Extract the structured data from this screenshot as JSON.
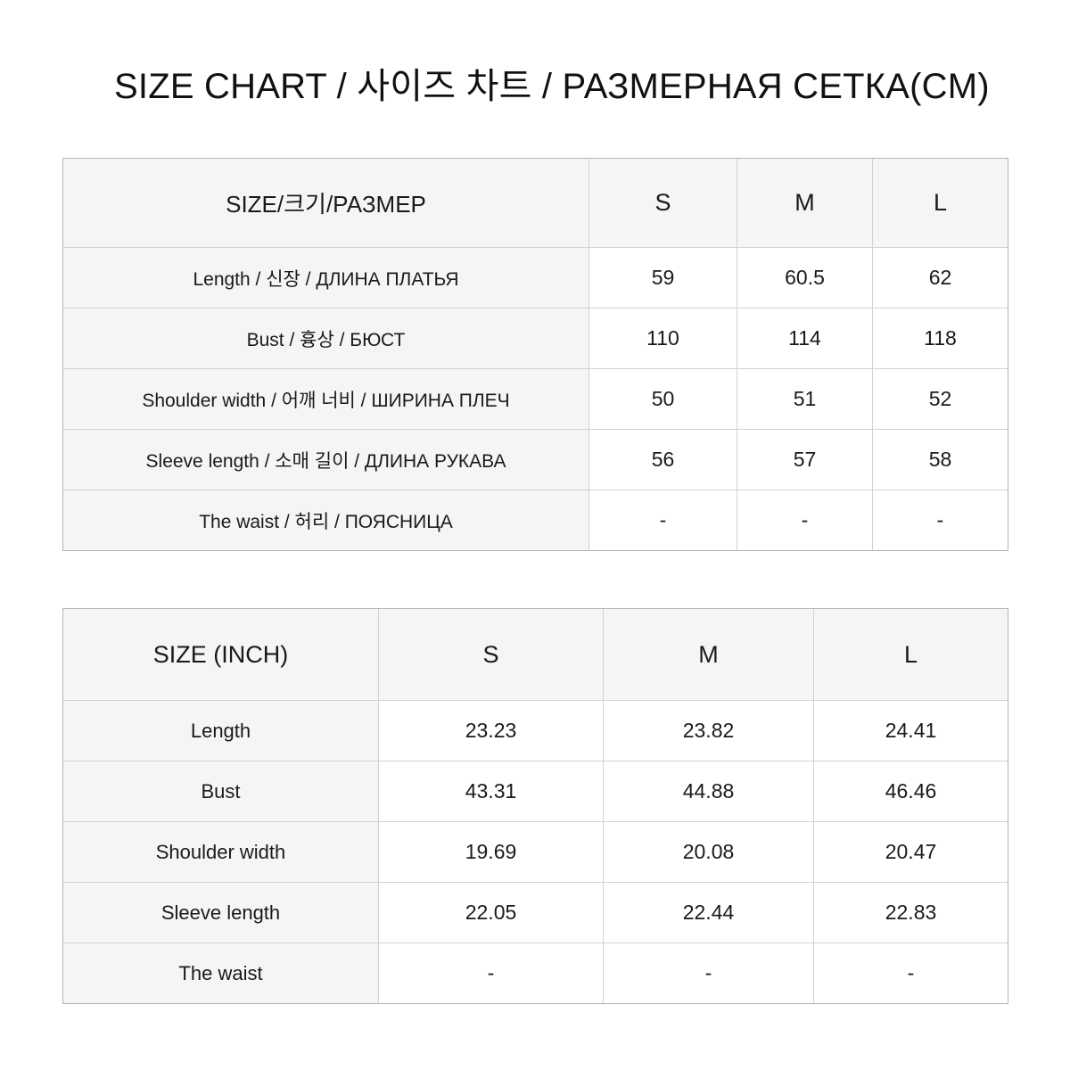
{
  "title": "SIZE CHART / 사이즈 차트 / РАЗМЕРНАЯ СЕТКА(CM)",
  "colors": {
    "page_background": "#ffffff",
    "header_cell_background": "#f5f5f5",
    "label_cell_background": "#f5f5f5",
    "value_cell_background": "#ffffff",
    "grid_line": "#d2d2d2",
    "outer_border": "#b5b5b5",
    "text": "#1a1a1a"
  },
  "chart_data": {
    "type": "table",
    "title": "SIZE CHART / 사이즈 차트 / РАЗМЕРНАЯ СЕТКА(CM)",
    "tables": [
      {
        "name": "centimeters",
        "unit": "CM",
        "columns": [
          "SIZE/크기/РАЗМЕР",
          "S",
          "M",
          "L"
        ],
        "rows": [
          {
            "label": "Length  / 신장  / ДЛИНА ПЛАТЬЯ",
            "S": "59",
            "M": "60.5",
            "L": "62"
          },
          {
            "label": "Bust  / 흉상  / БЮСТ",
            "S": "110",
            "M": "114",
            "L": "118"
          },
          {
            "label": "Shoulder width  / 어깨 너비  / ШИРИНА ПЛЕЧ",
            "S": "50",
            "M": "51",
            "L": "52"
          },
          {
            "label": "Sleeve length / 소매 길이  / ДЛИНА РУКАВА",
            "S": "56",
            "M": "57",
            "L": "58"
          },
          {
            "label": "The waist  / 허리  / ПОЯСНИЦА",
            "S": "-",
            "M": "-",
            "L": "-"
          }
        ]
      },
      {
        "name": "inches",
        "unit": "INCH",
        "columns": [
          "SIZE (INCH)",
          "S",
          "M",
          "L"
        ],
        "rows": [
          {
            "label": "Length",
            "S": "23.23",
            "M": "23.82",
            "L": "24.41"
          },
          {
            "label": "Bust",
            "S": "43.31",
            "M": "44.88",
            "L": "46.46"
          },
          {
            "label": "Shoulder width",
            "S": "19.69",
            "M": "20.08",
            "L": "20.47"
          },
          {
            "label": "Sleeve length",
            "S": "22.05",
            "M": "22.44",
            "L": "22.83"
          },
          {
            "label": "The waist",
            "S": "-",
            "M": "-",
            "L": "-"
          }
        ]
      }
    ]
  },
  "table_cm": {
    "header": {
      "label": "SIZE/크기/РАЗМЕР",
      "s": "S",
      "m": "M",
      "l": "L"
    },
    "rows": [
      {
        "label": "Length  / 신장  / ДЛИНА ПЛАТЬЯ",
        "s": "59",
        "m": "60.5",
        "l": "62"
      },
      {
        "label": "Bust  / 흉상  / БЮСТ",
        "s": "110",
        "m": "114",
        "l": "118"
      },
      {
        "label": "Shoulder width  / 어깨 너비  / ШИРИНА ПЛЕЧ",
        "s": "50",
        "m": "51",
        "l": "52"
      },
      {
        "label": "Sleeve length / 소매 길이  / ДЛИНА РУКАВА",
        "s": "56",
        "m": "57",
        "l": "58"
      },
      {
        "label": "The waist  / 허리  / ПОЯСНИЦА",
        "s": "-",
        "m": "-",
        "l": "-"
      }
    ]
  },
  "table_inch": {
    "header": {
      "label": "SIZE (INCH)",
      "s": "S",
      "m": "M",
      "l": "L"
    },
    "rows": [
      {
        "label": "Length",
        "s": "23.23",
        "m": "23.82",
        "l": "24.41"
      },
      {
        "label": "Bust",
        "s": "43.31",
        "m": "44.88",
        "l": "46.46"
      },
      {
        "label": "Shoulder width",
        "s": "19.69",
        "m": "20.08",
        "l": "20.47"
      },
      {
        "label": "Sleeve length",
        "s": "22.05",
        "m": "22.44",
        "l": "22.83"
      },
      {
        "label": "The waist",
        "s": "-",
        "m": "-",
        "l": "-"
      }
    ]
  }
}
